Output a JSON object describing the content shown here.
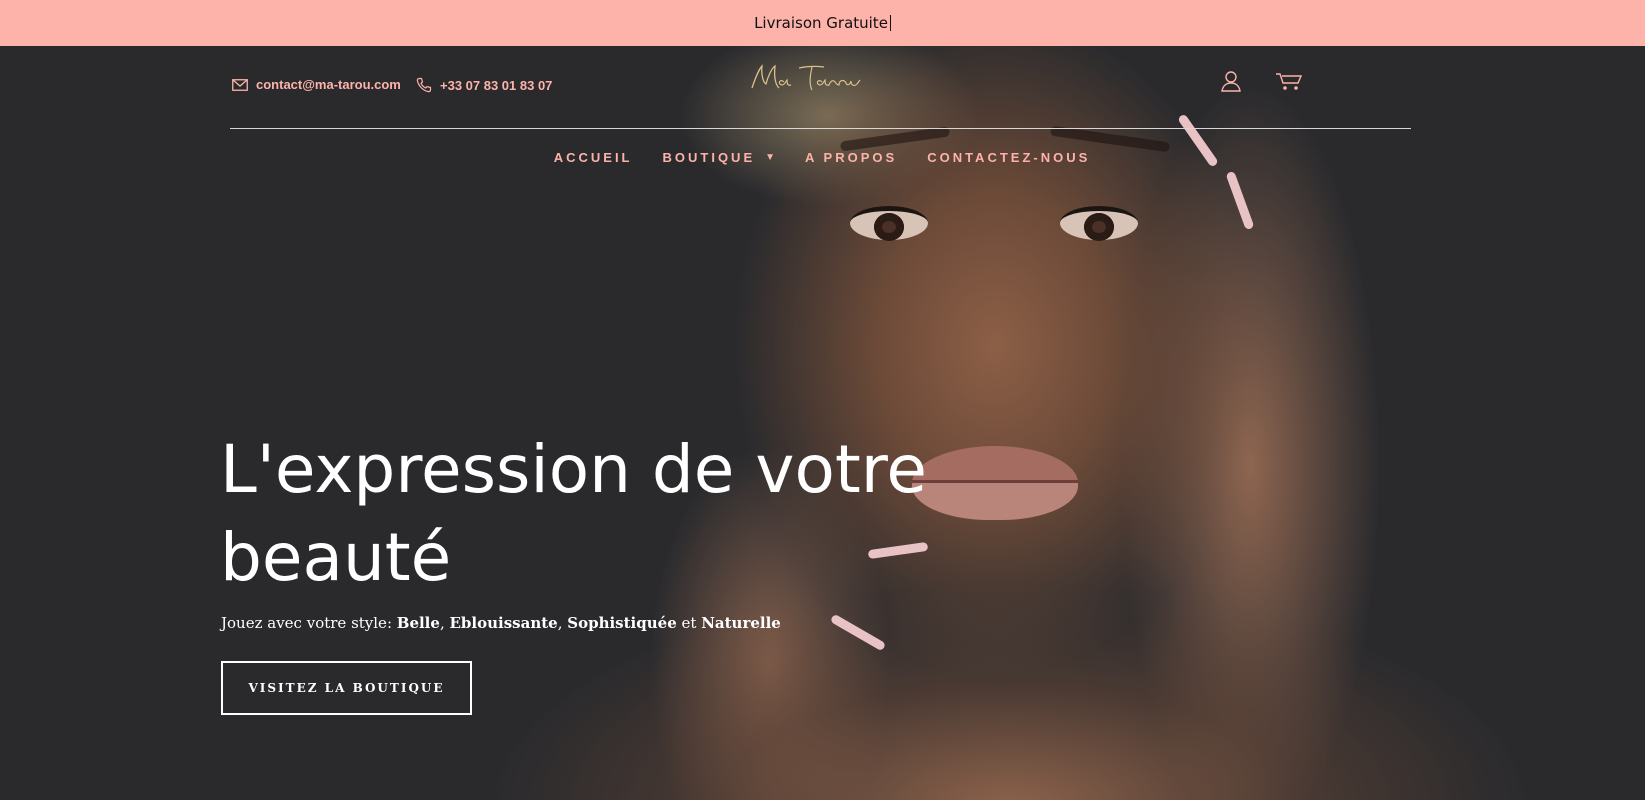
{
  "announcement": {
    "text": "Livraison Gratuite"
  },
  "topbar": {
    "email": "contact@ma-tarou.com",
    "phone": "+33 07 83 01 83 07",
    "logo_text": "Ma Tarou",
    "icons": [
      "mail-icon",
      "phone-icon",
      "user-icon",
      "cart-icon"
    ]
  },
  "nav": {
    "items": [
      {
        "label": "ACCUEIL"
      },
      {
        "label": "BOUTIQUE",
        "has_dropdown": true
      },
      {
        "label": "A PROPOS"
      },
      {
        "label": "CONTACTEZ-NOUS"
      }
    ]
  },
  "hero": {
    "headline_line1": "L'expression de votre",
    "headline_line2": "beauté",
    "tagline_prefix": "Jouez avec votre style: ",
    "tagline_word1": "Belle",
    "tagline_sep1": ", ",
    "tagline_word2": "Eblouissante",
    "tagline_sep2": ", ",
    "tagline_word3": "Sophistiquée",
    "tagline_sep3": " et ",
    "tagline_word4": "Naturelle",
    "cta_label": "VISITEZ LA BOUTIQUE"
  },
  "colors": {
    "accent": "#fdb3aa",
    "announcement_bg": "#fdb3aa",
    "hero_bg": "#2a2a2d",
    "text_light": "#ffffff"
  }
}
